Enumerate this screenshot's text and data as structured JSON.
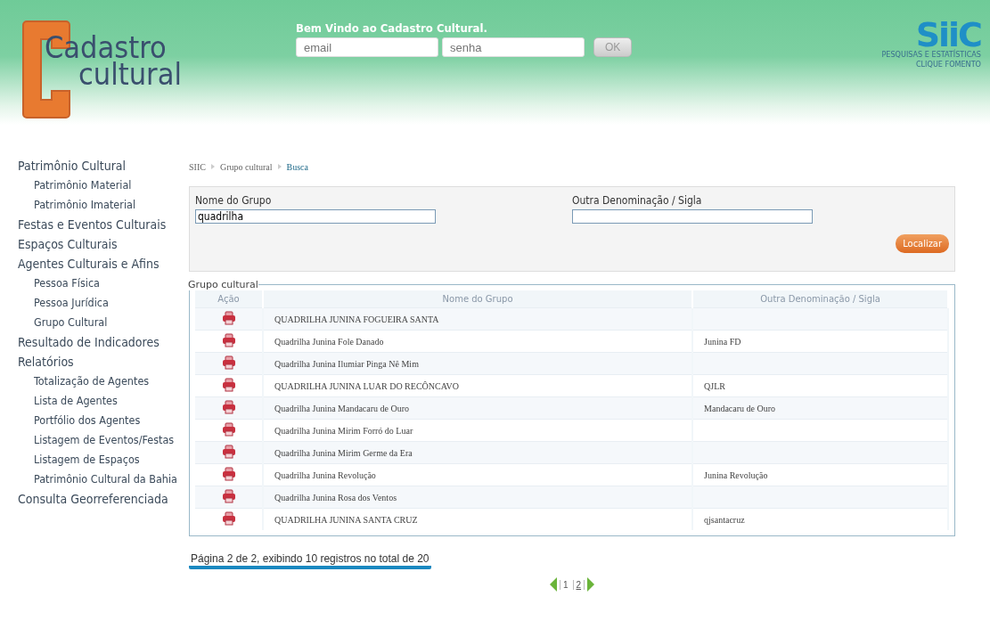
{
  "header": {
    "logo_lines": [
      "Cadastro",
      "cultural"
    ],
    "welcome": "Bem Vindo ao Cadastro Cultural.",
    "login": {
      "email_placeholder": "email",
      "password_placeholder": "senha",
      "button": "OK"
    },
    "partner": {
      "name": "SiiC",
      "lines": [
        "PESQUISAS E ESTATÍSTICAS",
        "CLIQUE FOMENTO"
      ]
    }
  },
  "sidebar": {
    "items": [
      {
        "label": "Patrimônio Cultural",
        "children": [
          {
            "label": "Patrimônio Material"
          },
          {
            "label": "Patrimônio Imaterial"
          }
        ]
      },
      {
        "label": "Festas e Eventos Culturais"
      },
      {
        "label": "Espaços Culturais"
      },
      {
        "label": "Agentes Culturais e Afins",
        "children": [
          {
            "label": "Pessoa Física"
          },
          {
            "label": "Pessoa Jurídica"
          },
          {
            "label": "Grupo Cultural"
          }
        ]
      },
      {
        "label": "Resultado de Indicadores"
      },
      {
        "label": "Relatórios",
        "children": [
          {
            "label": "Totalização de Agentes"
          },
          {
            "label": "Lista de Agentes"
          },
          {
            "label": "Portfólio dos Agentes"
          },
          {
            "label": "Listagem de Eventos/Festas"
          },
          {
            "label": "Listagem de Espaços"
          },
          {
            "label": "Patrimônio Cultural da Bahia"
          }
        ]
      },
      {
        "label": "Consulta Georreferenciada"
      }
    ]
  },
  "breadcrumb": [
    {
      "label": "SIIC",
      "current": false
    },
    {
      "label": "Grupo cultural",
      "current": false
    },
    {
      "label": "Busca",
      "current": true
    }
  ],
  "search": {
    "fields": [
      {
        "label": "Nome do Grupo",
        "value": "quadrilha"
      },
      {
        "label": "Outra Denominação / Sigla"
      }
    ],
    "button": "Localizar"
  },
  "results": {
    "legend": "Grupo cultural",
    "columns": [
      "Ação",
      "Nome do Grupo",
      "Outra Denominação / Sigla"
    ],
    "rows": [
      {
        "name": "QUADRILHA JUNINA FOGUEIRA SANTA"
      },
      {
        "name": "Quadrilha Junina Fole Danado",
        "alias": "Junina FD"
      },
      {
        "name": "Quadrilha Junina Ilumiar Pinga Nê Mim"
      },
      {
        "name": "QUADRILHA JUNINA LUAR DO RECÔNCAVO",
        "alias": "QJLR"
      },
      {
        "name": "Quadrilha Junina Mandacaru de Ouro",
        "alias": "Mandacaru de Ouro"
      },
      {
        "name": "Quadrilha Junina Mirim Forró do Luar"
      },
      {
        "name": "Quadrilha Junina Mirim Germe da Era"
      },
      {
        "name": "Quadrilha Junina Revolução",
        "alias": "Junina Revolução"
      },
      {
        "name": "Quadrilha Junina Rosa dos Ventos"
      },
      {
        "name": "QUADRILHA JUNINA SANTA CRUZ",
        "alias": "qjsantacruz"
      }
    ]
  },
  "pagination": {
    "summary": "Página 2 de 2, exibindo 10 registros no total de 20",
    "pages": [
      {
        "label": "1",
        "selected": false
      },
      {
        "label": "2",
        "selected": true
      }
    ]
  }
}
